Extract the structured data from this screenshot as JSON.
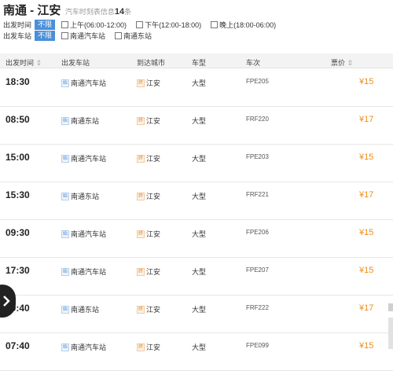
{
  "header": {
    "title": "南通 - 江安",
    "subtitle": "汽车时刻表信息",
    "count": "14",
    "unit": "条"
  },
  "filters": {
    "time": {
      "label": "出发时间",
      "selected": "不限",
      "options": [
        "上午(06:00-12:00)",
        "下午(12:00-18:00)",
        "晚上(18:00-06:00)"
      ]
    },
    "station": {
      "label": "出发车站",
      "selected": "不限",
      "options": [
        "南通汽车站",
        "南通东站"
      ]
    }
  },
  "table": {
    "headers": {
      "time": "出发时间",
      "station": "出发车站",
      "city": "到达城市",
      "type": "车型",
      "code": "车次",
      "price": "票价"
    },
    "sort_arrow": "⇕",
    "station_tag": "始",
    "city_tag": "终",
    "rows": [
      {
        "time": "18:30",
        "station": "南通汽车站",
        "city": "江安",
        "type": "大型",
        "code": "FPE205",
        "price": "¥15"
      },
      {
        "time": "08:50",
        "station": "南通东站",
        "city": "江安",
        "type": "大型",
        "code": "FRF220",
        "price": "¥17"
      },
      {
        "time": "15:00",
        "station": "南通汽车站",
        "city": "江安",
        "type": "大型",
        "code": "FPE203",
        "price": "¥15"
      },
      {
        "time": "15:30",
        "station": "南通东站",
        "city": "江安",
        "type": "大型",
        "code": "FRF221",
        "price": "¥17"
      },
      {
        "time": "09:30",
        "station": "南通汽车站",
        "city": "江安",
        "type": "大型",
        "code": "FPE206",
        "price": "¥15"
      },
      {
        "time": "17:30",
        "station": "南通汽车站",
        "city": "江安",
        "type": "大型",
        "code": "FPE207",
        "price": "¥15"
      },
      {
        "time": "09:40",
        "station": "南通东站",
        "city": "江安",
        "type": "大型",
        "code": "FRF222",
        "price": "¥17"
      },
      {
        "time": "07:40",
        "station": "南通汽车站",
        "city": "江安",
        "type": "大型",
        "code": "FPE099",
        "price": "¥15"
      }
    ]
  }
}
